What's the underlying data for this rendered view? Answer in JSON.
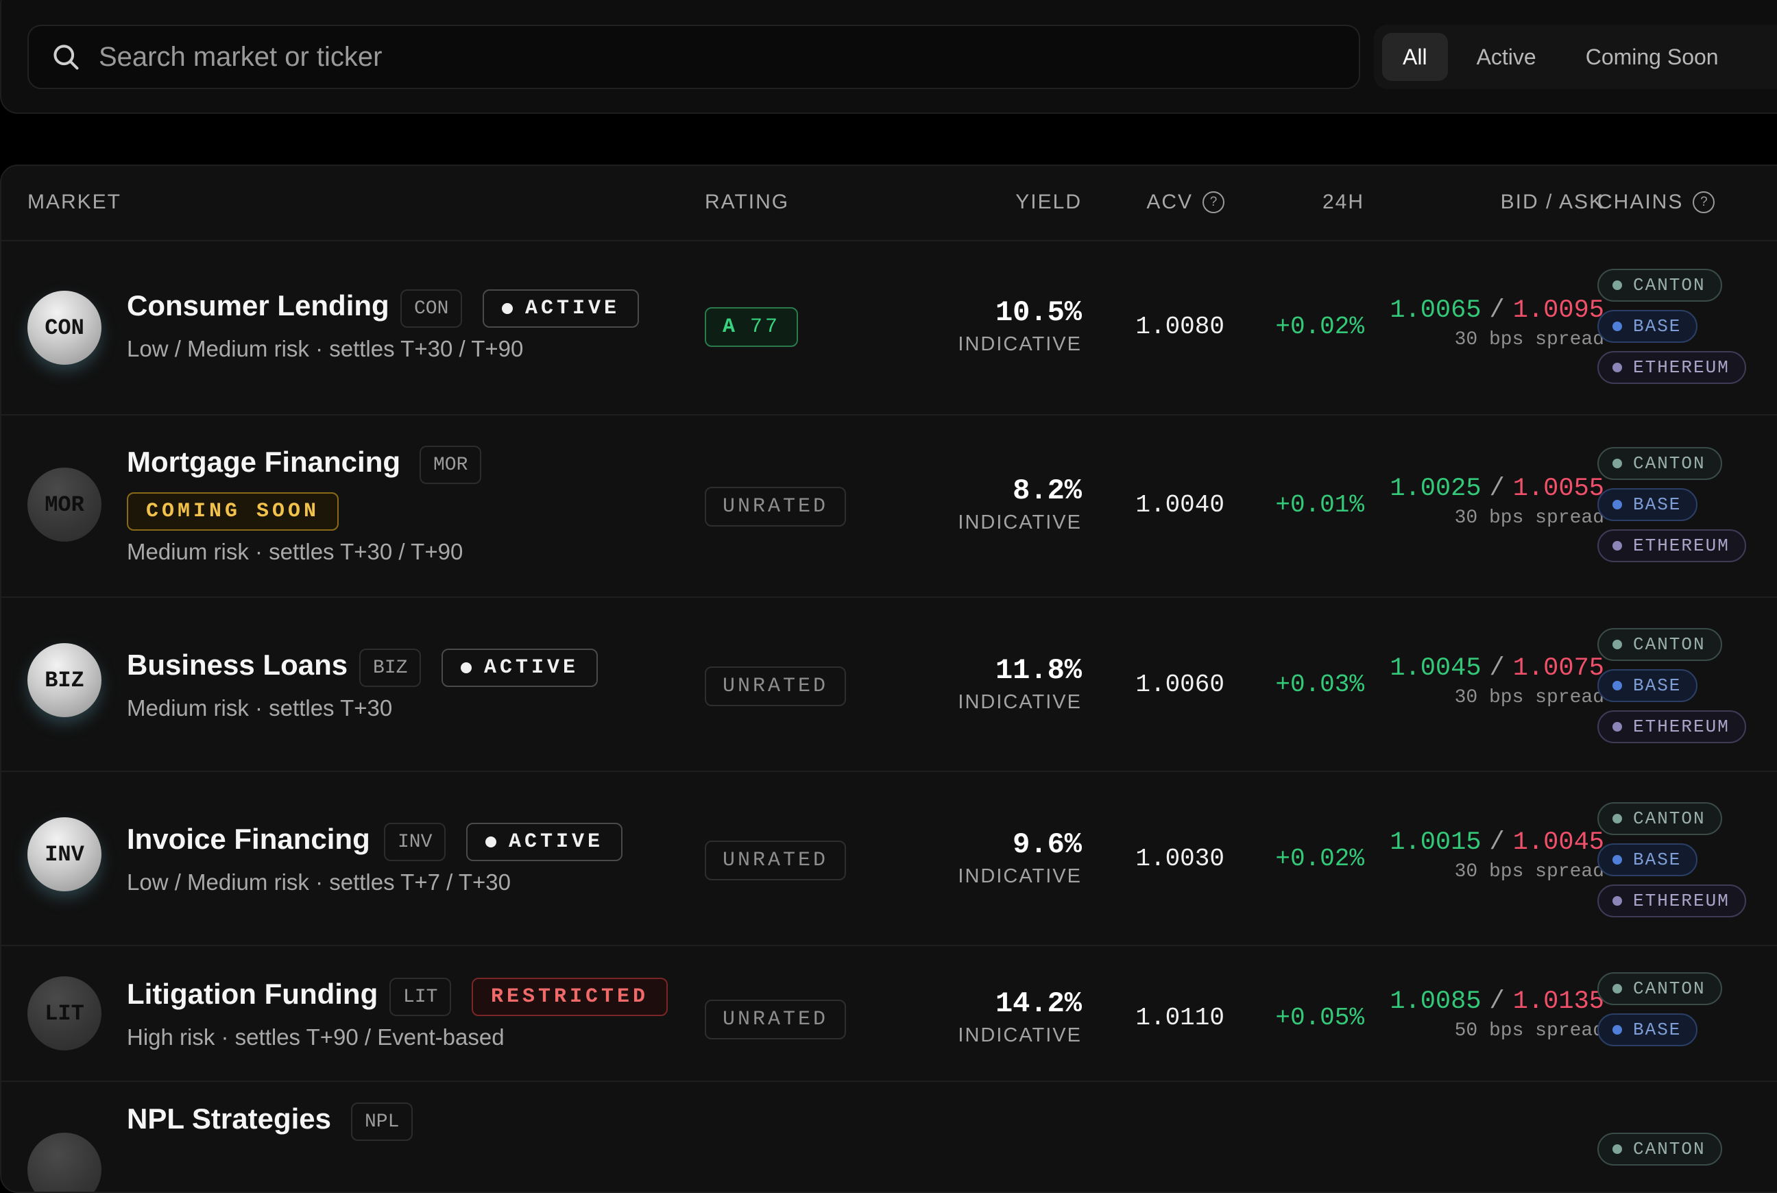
{
  "search": {
    "placeholder": "Search market or ticker"
  },
  "filters": [
    {
      "label": "All",
      "active": true
    },
    {
      "label": "Active",
      "active": false
    },
    {
      "label": "Coming Soon",
      "active": false
    }
  ],
  "columns": {
    "market": "MARKET",
    "rating": "RATING",
    "yield": "YIELD",
    "acv": "ACV",
    "h24": "24H",
    "bid_ask": "BID / ASK",
    "chains": "CHAINS"
  },
  "rows": [
    {
      "avatar": "CON",
      "name": "Consumer Lending",
      "ticker": "CON",
      "status": "ACTIVE",
      "desc": "Low / Medium risk · settles T+30 / T+90",
      "rating_grade": "A",
      "rating_score": "77",
      "rating": "",
      "yield": "10.5%",
      "yield_label": "INDICATIVE",
      "acv": "1.0080",
      "change": "+0.02%",
      "bid": "1.0065",
      "sep": "/",
      "ask": "1.0095",
      "spread": "30 bps spread",
      "chains": [
        "CANTON",
        "BASE",
        "ETHEREUM"
      ]
    },
    {
      "avatar": "MOR",
      "name": "Mortgage Financing",
      "ticker": "MOR",
      "status": "COMING SOON",
      "desc": "Medium risk · settles T+30 / T+90",
      "rating": "UNRATED",
      "yield": "8.2%",
      "yield_label": "INDICATIVE",
      "acv": "1.0040",
      "change": "+0.01%",
      "bid": "1.0025",
      "sep": "/",
      "ask": "1.0055",
      "spread": "30 bps spread",
      "chains": [
        "CANTON",
        "BASE",
        "ETHEREUM"
      ]
    },
    {
      "avatar": "BIZ",
      "name": "Business Loans",
      "ticker": "BIZ",
      "status": "ACTIVE",
      "desc": "Medium risk · settles T+30",
      "rating": "UNRATED",
      "yield": "11.8%",
      "yield_label": "INDICATIVE",
      "acv": "1.0060",
      "change": "+0.03%",
      "bid": "1.0045",
      "sep": "/",
      "ask": "1.0075",
      "spread": "30 bps spread",
      "chains": [
        "CANTON",
        "BASE",
        "ETHEREUM"
      ]
    },
    {
      "avatar": "INV",
      "name": "Invoice Financing",
      "ticker": "INV",
      "status": "ACTIVE",
      "desc": "Low / Medium risk · settles T+7 / T+30",
      "rating": "UNRATED",
      "yield": "9.6%",
      "yield_label": "INDICATIVE",
      "acv": "1.0030",
      "change": "+0.02%",
      "bid": "1.0015",
      "sep": "/",
      "ask": "1.0045",
      "spread": "30 bps spread",
      "chains": [
        "CANTON",
        "BASE",
        "ETHEREUM"
      ]
    },
    {
      "avatar": "LIT",
      "name": "Litigation Funding",
      "ticker": "LIT",
      "status": "RESTRICTED",
      "desc": "High risk · settles T+90 / Event-based",
      "rating": "UNRATED",
      "yield": "14.2%",
      "yield_label": "INDICATIVE",
      "acv": "1.0110",
      "change": "+0.05%",
      "bid": "1.0085",
      "sep": "/",
      "ask": "1.0135",
      "spread": "50 bps spread",
      "chains": [
        "CANTON",
        "BASE"
      ]
    },
    {
      "name": "NPL Strategies",
      "ticker": "NPL",
      "chains": [
        "CANTON"
      ]
    }
  ]
}
